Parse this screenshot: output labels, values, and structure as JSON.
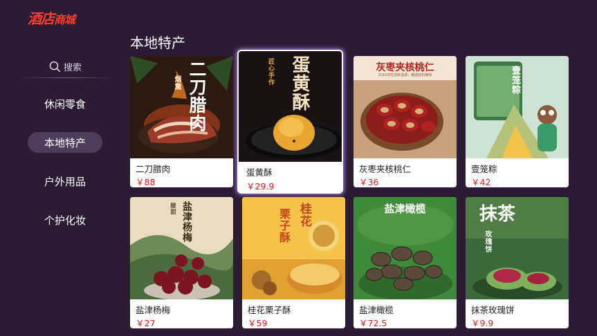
{
  "app": {
    "logo_main": "酒店",
    "logo_sub": "商城"
  },
  "sidebar": {
    "search_label": "搜索",
    "items": [
      {
        "label": "休闲零食",
        "active": false
      },
      {
        "label": "本地特产",
        "active": true
      },
      {
        "label": "户外用品",
        "active": false
      },
      {
        "label": "个护化妆",
        "active": false
      }
    ]
  },
  "main": {
    "title": "本地特产",
    "products": [
      {
        "name": "二刀腊肉",
        "price": "￥88",
        "art_title": "二刀腊肉",
        "art_tag": "烟熏"
      },
      {
        "name": "蛋黄酥",
        "price": "￥29.9",
        "art_title": "蛋黄酥",
        "art_tag": "匠心手作"
      },
      {
        "name": "灰枣夹核桃仁",
        "price": "￥36",
        "art_title": "灰枣夹核桃仁",
        "art_sub": "2016年吃货新选择，精选好料美味"
      },
      {
        "name": "壹笼粽",
        "price": "￥42",
        "art_title": "壹笼粽",
        "art_badge": "壹笼粽"
      },
      {
        "name": "盐津杨梅",
        "price": "￥27",
        "art_title": "盐津杨梅",
        "art_tag": "酸甜"
      },
      {
        "name": "桂花栗子酥",
        "price": "￥59",
        "art_title": "桂花",
        "art_title2": "栗子酥"
      },
      {
        "name": "盐津橄榄",
        "price": "￥72.5",
        "art_title": "盐津橄榄"
      },
      {
        "name": "抹茶玫瑰饼",
        "price": "￥9.9",
        "art_title": "抹茶",
        "art_sub": "玫瑰饼"
      }
    ]
  },
  "colors": {
    "background": "#2b1c33",
    "accent": "#ff3d2e",
    "price": "#e3191c",
    "active_nav": "#4c3d5a",
    "focus_glow": "#b188ee"
  }
}
